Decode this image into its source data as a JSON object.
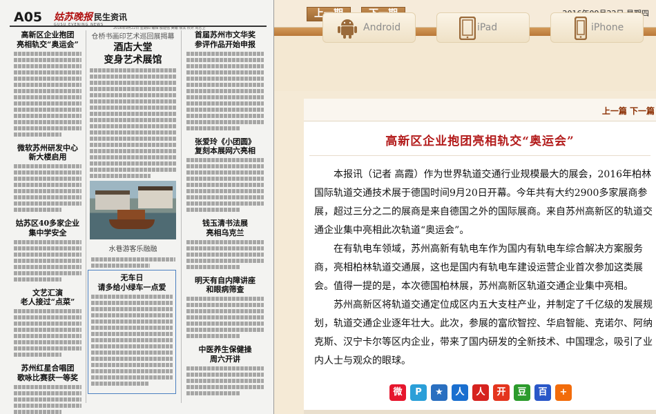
{
  "paper": {
    "page_no": "A05",
    "masthead": "姑苏晚报",
    "section": "民生资讯",
    "sub_masthead": "GUSU EVENING NEWS",
    "meta": "2016年9月22日  星期四  编辑 殷建强  美编 徐滨  校对 周志卫",
    "headlines": {
      "col1_1": "高新区企业抱团\n亮相轨交“奥运会”",
      "col1_2": "微软苏州研发中心\n新大楼启用",
      "col1_3": "姑苏区40多家企业\n集中学安全",
      "col1_4": "文艺汇演\n老人接过“点菜”",
      "col1_5": "苏州红星合唱团\n歌咏比赛获一等奖",
      "col2_kicker": "仓桥书画印艺术巡回展揭幕",
      "col2_1": "酒店大堂\n变身艺术展馆",
      "col2_photo_caption": "水巷游客乐融融",
      "col2_box": "无车日\n请多给小绿车一点爱",
      "col3_1": "首届苏州市文华奖\n参评作品开始申报",
      "col3_2": "张爱玲《小团圆》\n复刻本展网六亮相",
      "col3_3": "钱玉清书法展\n亮相乌克兰",
      "col3_4": "明天有自内障讲座\n和眼病筛查",
      "col3_5": "中医养生保健操\n周六开讲"
    }
  },
  "toolbar": {
    "prev_issue": "上一期",
    "next_issue": "下一期",
    "date": "2016年09月22日 星期四"
  },
  "devices": {
    "android": "Android",
    "ipad": "iPad",
    "iphone": "iPhone"
  },
  "article": {
    "nav": "上一篇 下一篇",
    "title": "高新区企业抱团亮相轨交“奥运会”",
    "paragraphs": [
      "本报讯（记者 高霞）作为世界轨道交通行业规模最大的展会，2016年柏林国际轨道交通技术展于德国时间9月20日开幕。今年共有大约2900多家展商参展，超过三分之二的展商是来自德国之外的国际展商。来自苏州高新区的轨道交通企业集中亮相此次轨道“奥运会”。",
      "在有轨电车领域，苏州高新有轨电车作为国内有轨电车综合解决方案服务商，亮相柏林轨道交通展，这也是国内有轨电车建设运营企业首次参加这类展会。值得一提的是，本次德国柏林展，苏州高新区轨道交通企业集中亮相。",
      "苏州高新区将轨道交通定位成区内五大支柱产业，并制定了千亿级的发展规划，轨道交通企业逐年壮大。此次，参展的富欣智控、华启智能、克诺尔、阿纳克斯、汉宁卡尔等区内企业，带来了国内研发的全新技术、中国理念，吸引了业内人士与观众的眼球。"
    ]
  },
  "share": [
    {
      "name": "weibo",
      "glyph": "微",
      "color": "#e6162d"
    },
    {
      "name": "qzone",
      "glyph": "P",
      "color": "#2b9fd8"
    },
    {
      "name": "star",
      "glyph": "★",
      "color": "#2a6fc0"
    },
    {
      "name": "renren",
      "glyph": "人",
      "color": "#1a6fcf"
    },
    {
      "name": "people",
      "glyph": "人",
      "color": "#d6231f"
    },
    {
      "name": "kaixin",
      "glyph": "开",
      "color": "#e4351e"
    },
    {
      "name": "douban",
      "glyph": "豆",
      "color": "#2c9b2c"
    },
    {
      "name": "baidu",
      "glyph": "百",
      "color": "#2a57c8"
    },
    {
      "name": "more",
      "glyph": "+",
      "color": "#f26c0b"
    }
  ]
}
